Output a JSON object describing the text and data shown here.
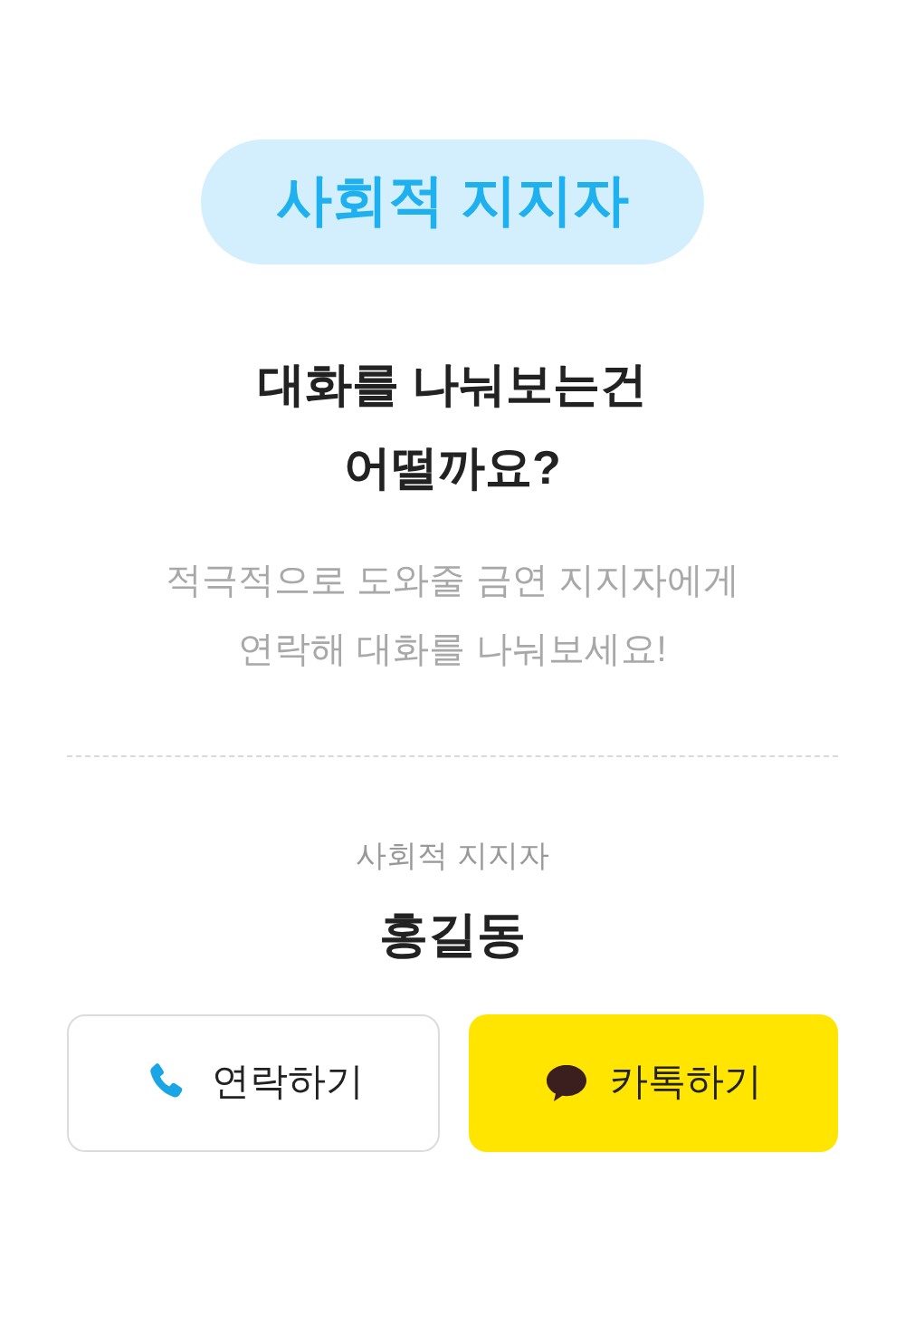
{
  "badge": "사회적 지지자",
  "title": [
    "대화를 나눠보는건",
    "어떨까요?"
  ],
  "description": [
    "적극적으로 도와줄 금연 지지자에게",
    "연락해 대화를 나눠보세요!"
  ],
  "supporter": {
    "label": "사회적 지지자",
    "name": "홍길동"
  },
  "buttons": [
    {
      "kind": "call",
      "label": "연락하기"
    },
    {
      "kind": "kakao",
      "label": "카톡하기"
    }
  ]
}
